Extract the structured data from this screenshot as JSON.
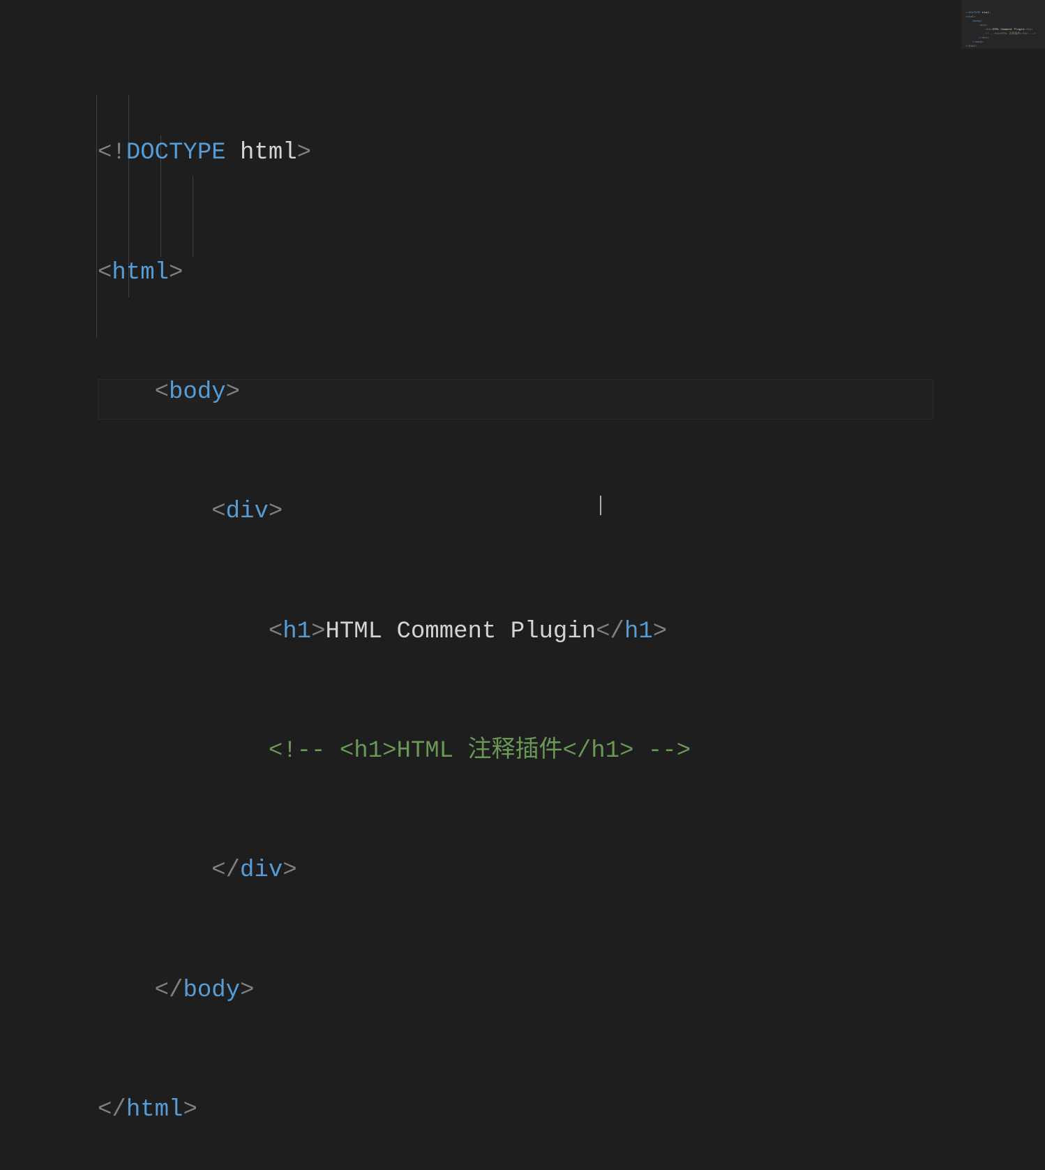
{
  "code": {
    "line1": {
      "open": "<!",
      "kw": "DOCTYPE",
      "val": " html",
      "close": ">"
    },
    "line2": {
      "open": "<",
      "tag": "html",
      "close": ">"
    },
    "line3": {
      "indent": "    ",
      "open": "<",
      "tag": "body",
      "close": ">"
    },
    "line4": {
      "indent": "        ",
      "open": "<",
      "tag": "div",
      "close": ">"
    },
    "line5": {
      "indent": "            ",
      "open1": "<",
      "tag1": "h1",
      "close1": ">",
      "text": "HTML Comment Plugin",
      "open2": "</",
      "tag2": "h1",
      "close2": ">"
    },
    "line6": {
      "indent": "            ",
      "comment": "<!-- <h1>HTML 注释插件</h1> -->"
    },
    "line7": {
      "indent": "        ",
      "open": "</",
      "tag": "div",
      "close": ">"
    },
    "line8": {
      "indent": "    ",
      "open": "</",
      "tag": "body",
      "close": ">"
    },
    "line9": {
      "open": "</",
      "tag": "html",
      "close": ">"
    }
  },
  "minimap": {
    "l1a": "<!",
    "l1b": "DOCTYPE",
    "l1c": " html",
    "l1d": ">",
    "l2a": "<",
    "l2b": "html",
    "l2c": ">",
    "l3a": "    <",
    "l3b": "body",
    "l3c": ">",
    "l4a": "        <",
    "l4b": "div",
    "l4c": ">",
    "l5a": "            <",
    "l5b": "h1",
    "l5c": ">",
    "l5d": "HTML Comment Plugin",
    "l5e": "</",
    "l5f": "h1",
    "l5g": ">",
    "l6": "            <!-- <h1>HTML 注释插件</h1> -->",
    "l7a": "        </",
    "l7b": "div",
    "l7c": ">",
    "l8a": "    </",
    "l8b": "body",
    "l8c": ">",
    "l9a": "</",
    "l9b": "html",
    "l9c": ">"
  }
}
